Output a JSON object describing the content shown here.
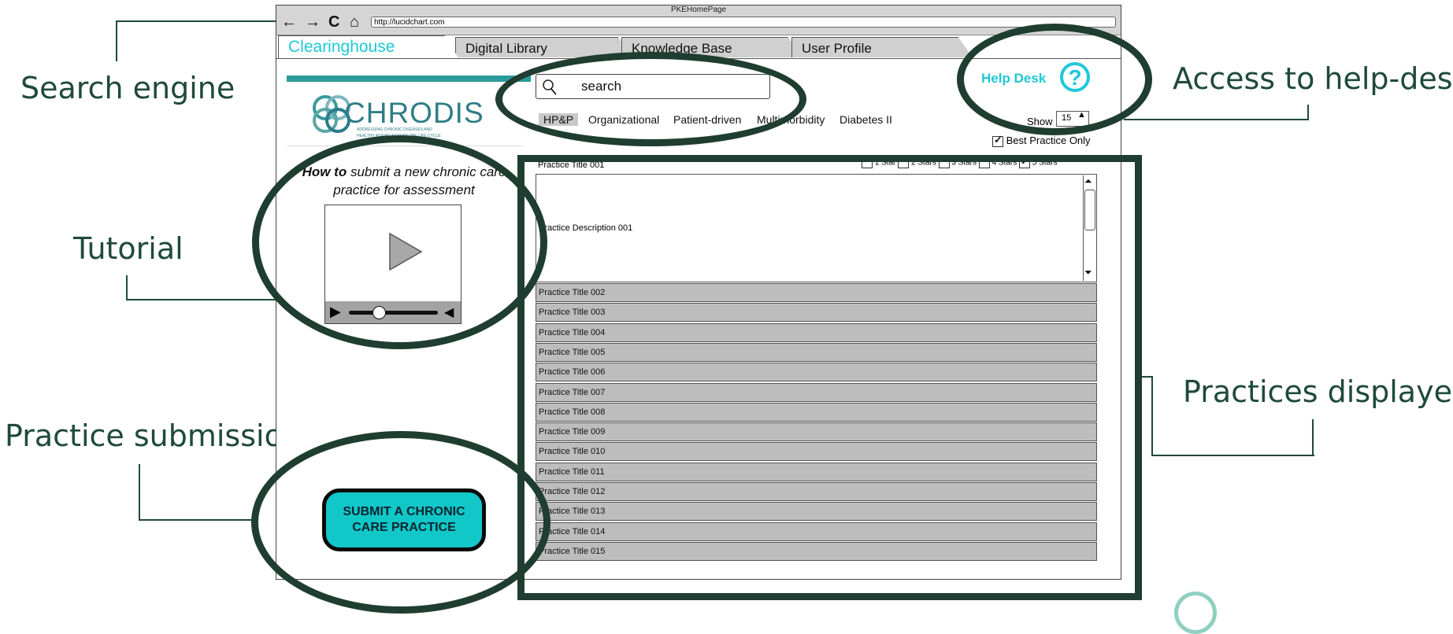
{
  "browser": {
    "title": "PKEHomePage",
    "url": "http://lucidchart.com",
    "nav": {
      "back": "←",
      "forward": "→",
      "reload": "C",
      "home": "⌂"
    }
  },
  "tabs": [
    "Clearinghouse",
    "Digital Library",
    "Knowledge Base",
    "User Profile"
  ],
  "logo": {
    "name": "CHRODIS",
    "tagline1": "ADDRESSING CHRONIC DISEASES AND",
    "tagline2": "HEALTHY AGEING ACROSS THE LIFE CYCLE"
  },
  "search": {
    "placeholder": "search"
  },
  "filters": [
    "HP&P",
    "Organizational",
    "Patient-driven",
    "Multimorbidity",
    "Diabetes II"
  ],
  "helpdesk": {
    "label": "Help Desk",
    "icon": "question-icon"
  },
  "show": {
    "label": "Show",
    "value": "15"
  },
  "best_practice": {
    "label": "Best Practice Only",
    "checked": true
  },
  "stars": [
    {
      "label": "1 Star",
      "checked": false
    },
    {
      "label": "2 Stars",
      "checked": false
    },
    {
      "label": "3 Stars",
      "checked": false
    },
    {
      "label": "4 Stars",
      "checked": false
    },
    {
      "label": "5 Stars",
      "checked": true
    }
  ],
  "tutorial": {
    "bold": "How to",
    "rest": " submit a new chronic care practice for assessment"
  },
  "practices": {
    "first_title": "Practice Title 001",
    "first_description": "Practice Description 001",
    "titles": [
      "Practice Title 002",
      "Practice Title 003",
      "Practice Title 004",
      "Practice Title 005",
      "Practice Title 006",
      "Practice Title 007",
      "Practice Title 008",
      "Practice Title 009",
      "Practice Title 010",
      "Practice Title 011",
      "Practice Title 012",
      "Practice Title 013",
      "Practice Title 014",
      "Practice Title 015"
    ]
  },
  "submit_button": "SUBMIT A CHRONIC CARE PRACTICE",
  "callouts": {
    "search_engine": "Search engine",
    "tutorial": "Tutorial",
    "practice_submission": "Practice submission",
    "access_helpdesk": "Access to help-desk",
    "practices_displayed": "Practices displayed"
  },
  "colors": {
    "annotation": "#1f3d31",
    "accent": "#1ec8d8",
    "button": "#12c7c7"
  }
}
